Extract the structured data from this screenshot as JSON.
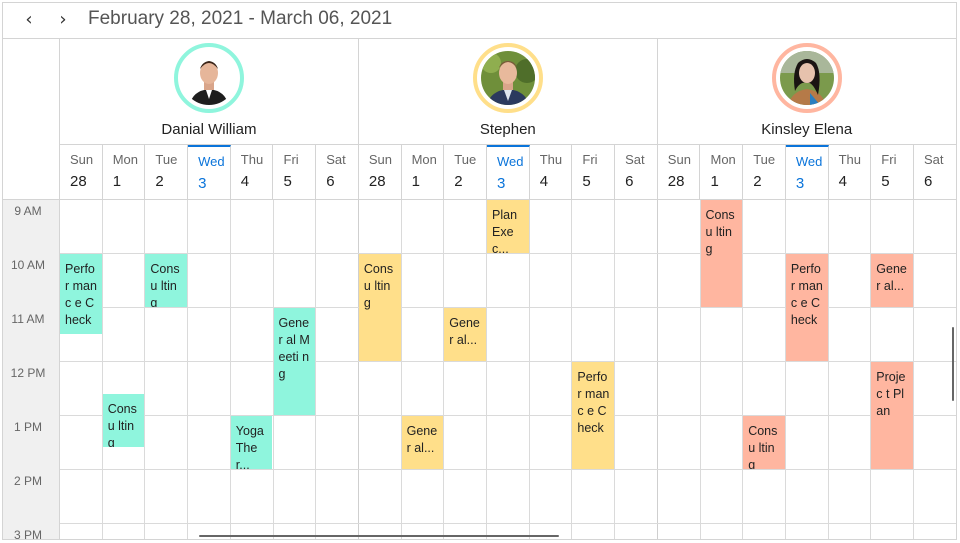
{
  "header": {
    "prev_icon": "‹",
    "next_icon": "›",
    "date_range": "February 28, 2021 - March 06, 2021"
  },
  "resources": [
    {
      "name": "Danial William",
      "color": "#8ff5dd",
      "avatar": "man-in-suit"
    },
    {
      "name": "Stephen",
      "color": "#ffdf8a",
      "avatar": "man-outdoors"
    },
    {
      "name": "Kinsley Elena",
      "color": "#ffb6a0",
      "avatar": "woman-dark-hair"
    }
  ],
  "days": [
    {
      "name": "Sun",
      "date": "28"
    },
    {
      "name": "Mon",
      "date": "1"
    },
    {
      "name": "Tue",
      "date": "2"
    },
    {
      "name": "Wed",
      "date": "3",
      "today": true
    },
    {
      "name": "Thu",
      "date": "4"
    },
    {
      "name": "Fri",
      "date": "5"
    },
    {
      "name": "Sat",
      "date": "6"
    }
  ],
  "today_color": "#0a74da",
  "time_slots": [
    "9 AM",
    "10 AM",
    "11 AM",
    "12 PM",
    "1 PM",
    "2 PM",
    "3 PM"
  ],
  "appointments": [
    {
      "resource": 0,
      "day": 0,
      "start": 10,
      "end": 11.5,
      "subject": "Perfor manc e Check"
    },
    {
      "resource": 0,
      "day": 2,
      "start": 10,
      "end": 11,
      "subject": "Consu lting"
    },
    {
      "resource": 0,
      "day": 5,
      "start": 11,
      "end": 13,
      "subject": "Gener al Meeti ng"
    },
    {
      "resource": 0,
      "day": 1,
      "start": 12.6,
      "end": 13.6,
      "subject": "Consu lting"
    },
    {
      "resource": 0,
      "day": 4,
      "start": 13,
      "end": 14,
      "subject": "Yoga Ther..."
    },
    {
      "resource": 1,
      "day": 3,
      "start": 9,
      "end": 10,
      "subject": "Plan Exec..."
    },
    {
      "resource": 1,
      "day": 0,
      "start": 10,
      "end": 12,
      "subject": "Consu lting"
    },
    {
      "resource": 1,
      "day": 2,
      "start": 11,
      "end": 12,
      "subject": "Gener al..."
    },
    {
      "resource": 1,
      "day": 5,
      "start": 12,
      "end": 14,
      "subject": "Perfor manc e Check"
    },
    {
      "resource": 1,
      "day": 1,
      "start": 13,
      "end": 14,
      "subject": "Gener al..."
    },
    {
      "resource": 2,
      "day": 1,
      "start": 9,
      "end": 11,
      "subject": "Consu lting"
    },
    {
      "resource": 2,
      "day": 3,
      "start": 10,
      "end": 12,
      "subject": "Perfor manc e Check"
    },
    {
      "resource": 2,
      "day": 5,
      "start": 10,
      "end": 11,
      "subject": "Gener al..."
    },
    {
      "resource": 2,
      "day": 5,
      "start": 12,
      "end": 14,
      "subject": "Projec t Plan"
    },
    {
      "resource": 2,
      "day": 2,
      "start": 13,
      "end": 14,
      "subject": "Consu lting"
    }
  ]
}
